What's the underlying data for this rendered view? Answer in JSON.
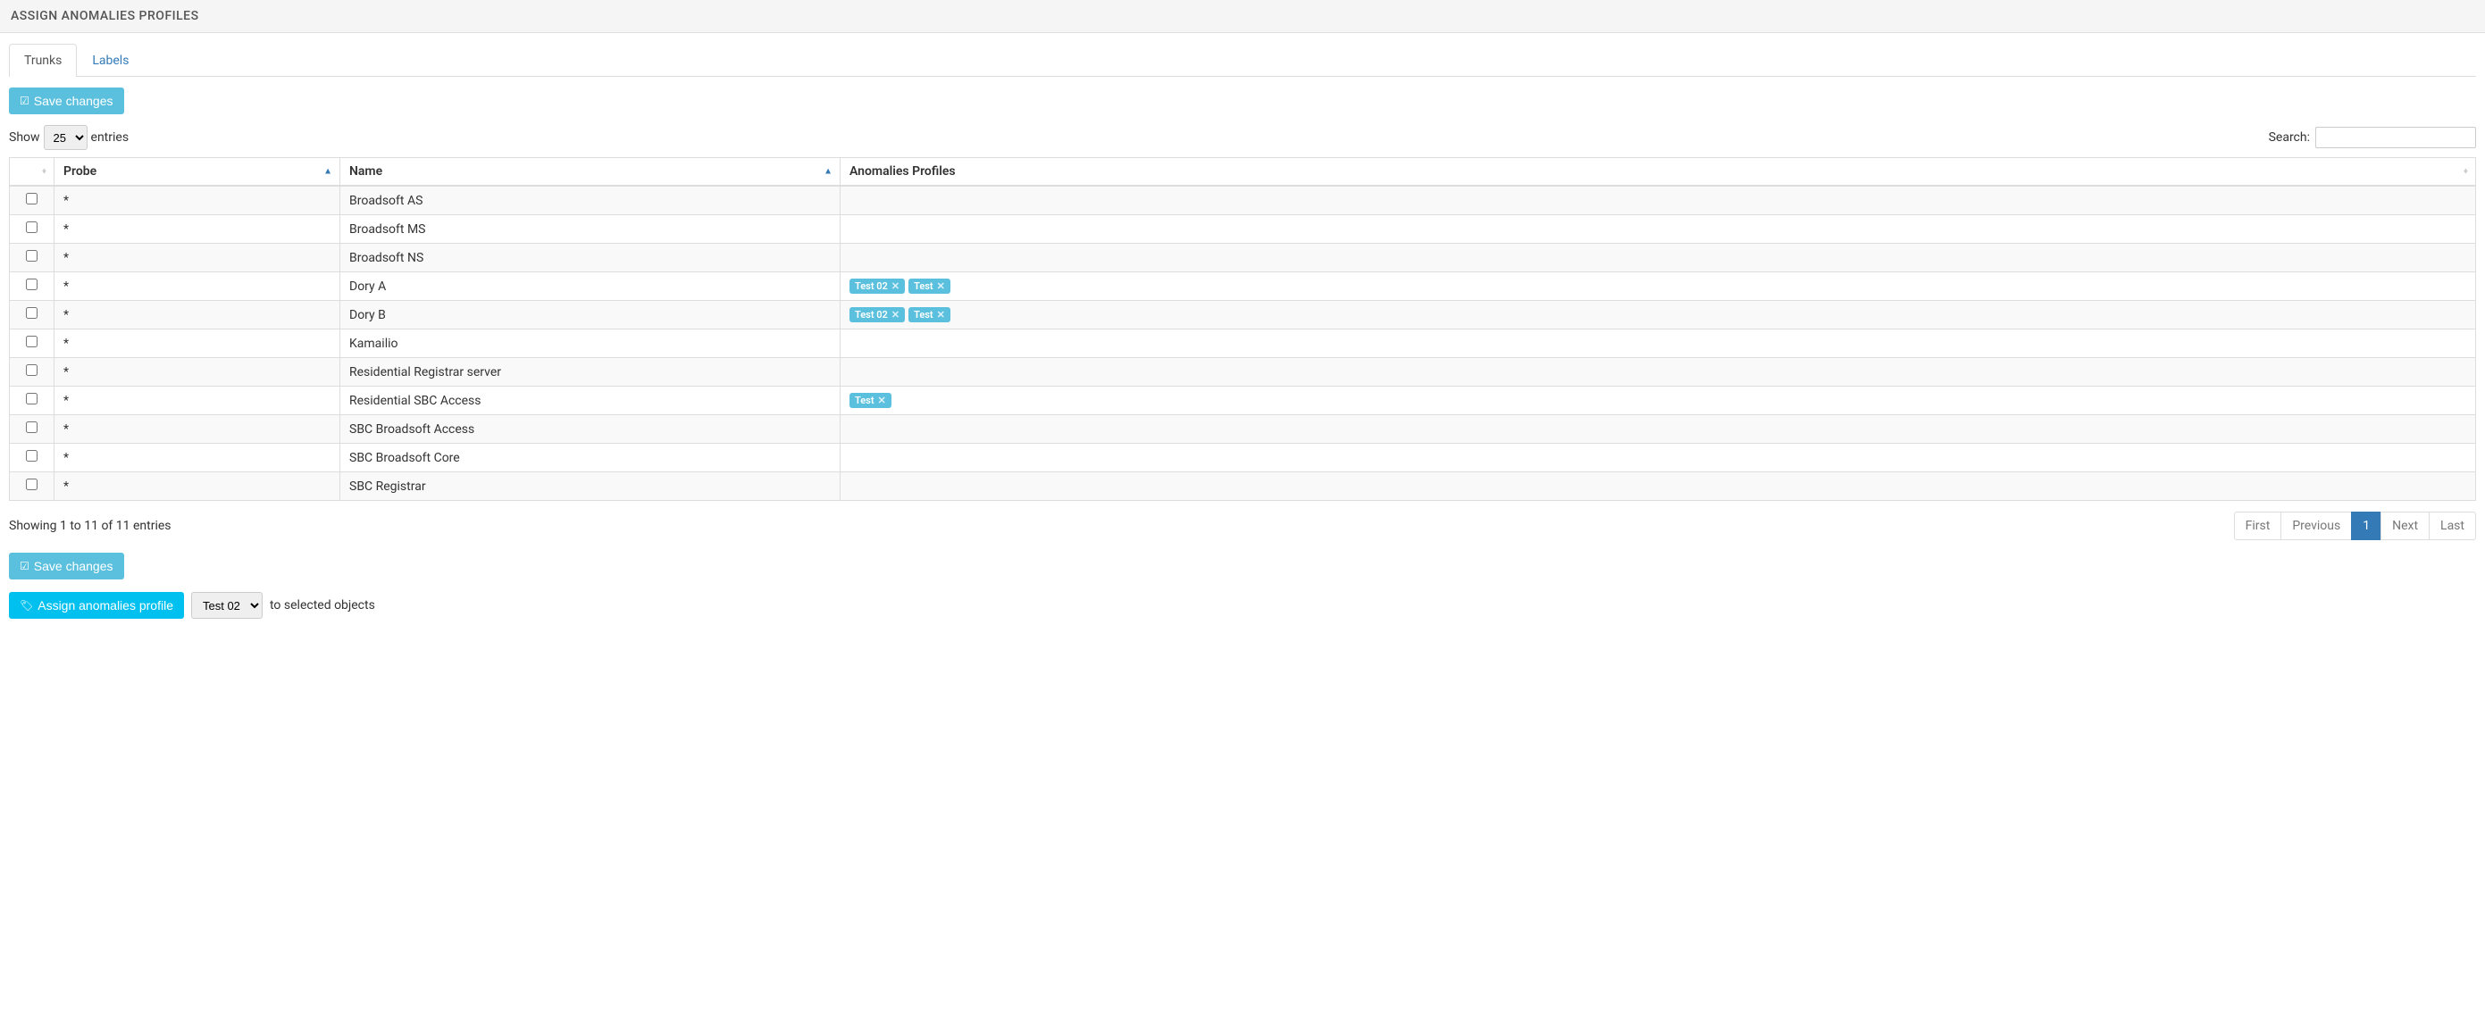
{
  "header": {
    "title": "ASSIGN ANOMALIES PROFILES"
  },
  "tabs": [
    {
      "label": "Trunks",
      "active": true
    },
    {
      "label": "Labels",
      "active": false
    }
  ],
  "buttons": {
    "save": "Save changes",
    "assign": "Assign anomalies profile"
  },
  "entries_control": {
    "show_label": "Show",
    "entries_label": "entries",
    "value": "25"
  },
  "search": {
    "label": "Search:",
    "value": ""
  },
  "table": {
    "columns": {
      "checkbox": "",
      "probe": "Probe",
      "name": "Name",
      "profiles": "Anomalies Profiles"
    },
    "rows": [
      {
        "probe": "*",
        "name": "Broadsoft AS",
        "profiles": []
      },
      {
        "probe": "*",
        "name": "Broadsoft MS",
        "profiles": []
      },
      {
        "probe": "*",
        "name": "Broadsoft NS",
        "profiles": []
      },
      {
        "probe": "*",
        "name": "Dory A",
        "profiles": [
          "Test 02",
          "Test"
        ]
      },
      {
        "probe": "*",
        "name": "Dory B",
        "profiles": [
          "Test 02",
          "Test"
        ]
      },
      {
        "probe": "*",
        "name": "Kamailio",
        "profiles": []
      },
      {
        "probe": "*",
        "name": "Residential Registrar server",
        "profiles": []
      },
      {
        "probe": "*",
        "name": "Residential SBC Access",
        "profiles": [
          "Test"
        ]
      },
      {
        "probe": "*",
        "name": "SBC Broadsoft Access",
        "profiles": []
      },
      {
        "probe": "*",
        "name": "SBC Broadsoft Core",
        "profiles": []
      },
      {
        "probe": "*",
        "name": "SBC Registrar",
        "profiles": []
      }
    ]
  },
  "footer": {
    "showing_text": "Showing 1 to 11 of 11 entries",
    "pagination": {
      "first": "First",
      "previous": "Previous",
      "pages": [
        "1"
      ],
      "active_page": "1",
      "next": "Next",
      "last": "Last"
    }
  },
  "assign_action": {
    "select_value": "Test 02",
    "suffix": "to selected objects"
  }
}
